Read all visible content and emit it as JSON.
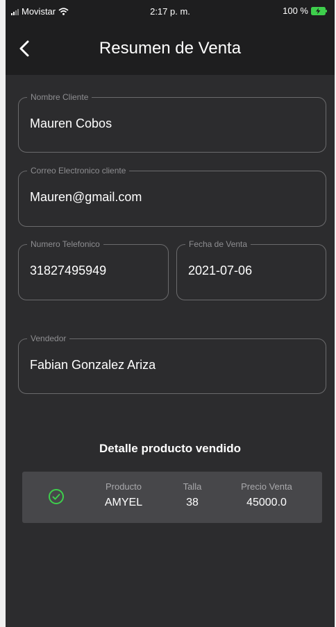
{
  "status_bar": {
    "carrier": "Movistar",
    "time": "2:17 p. m.",
    "battery": "100 %",
    "icons": [
      "signal-icon",
      "wifi-icon",
      "battery-charging-icon"
    ]
  },
  "nav": {
    "title": "Resumen de Venta",
    "back_icon": "chevron-left-icon"
  },
  "form": {
    "nombre_cliente": {
      "label": "Nombre Cliente",
      "value": "Mauren Cobos"
    },
    "correo": {
      "label": "Correo Electronico cliente",
      "value": "Mauren@gmail.com"
    },
    "telefono": {
      "label": "Numero Telefonico",
      "value": "31827495949"
    },
    "fecha": {
      "label": "Fecha de Venta",
      "value": "2021-07-06"
    },
    "vendedor": {
      "label": "Vendedor",
      "value": "Fabian Gonzalez Ariza"
    }
  },
  "detalle": {
    "title": "Detalle producto vendido",
    "status_icon": "check-circle-icon",
    "columns": {
      "producto": {
        "header": "Producto",
        "value": "AMYEL"
      },
      "talla": {
        "header": "Talla",
        "value": "38"
      },
      "precio": {
        "header": "Precio Venta",
        "value": "45000.0"
      }
    }
  },
  "colors": {
    "background": "#2c2c2e",
    "bar": "#1e1e1f",
    "card": "#47474a",
    "accent_green": "#3ecf4c"
  }
}
